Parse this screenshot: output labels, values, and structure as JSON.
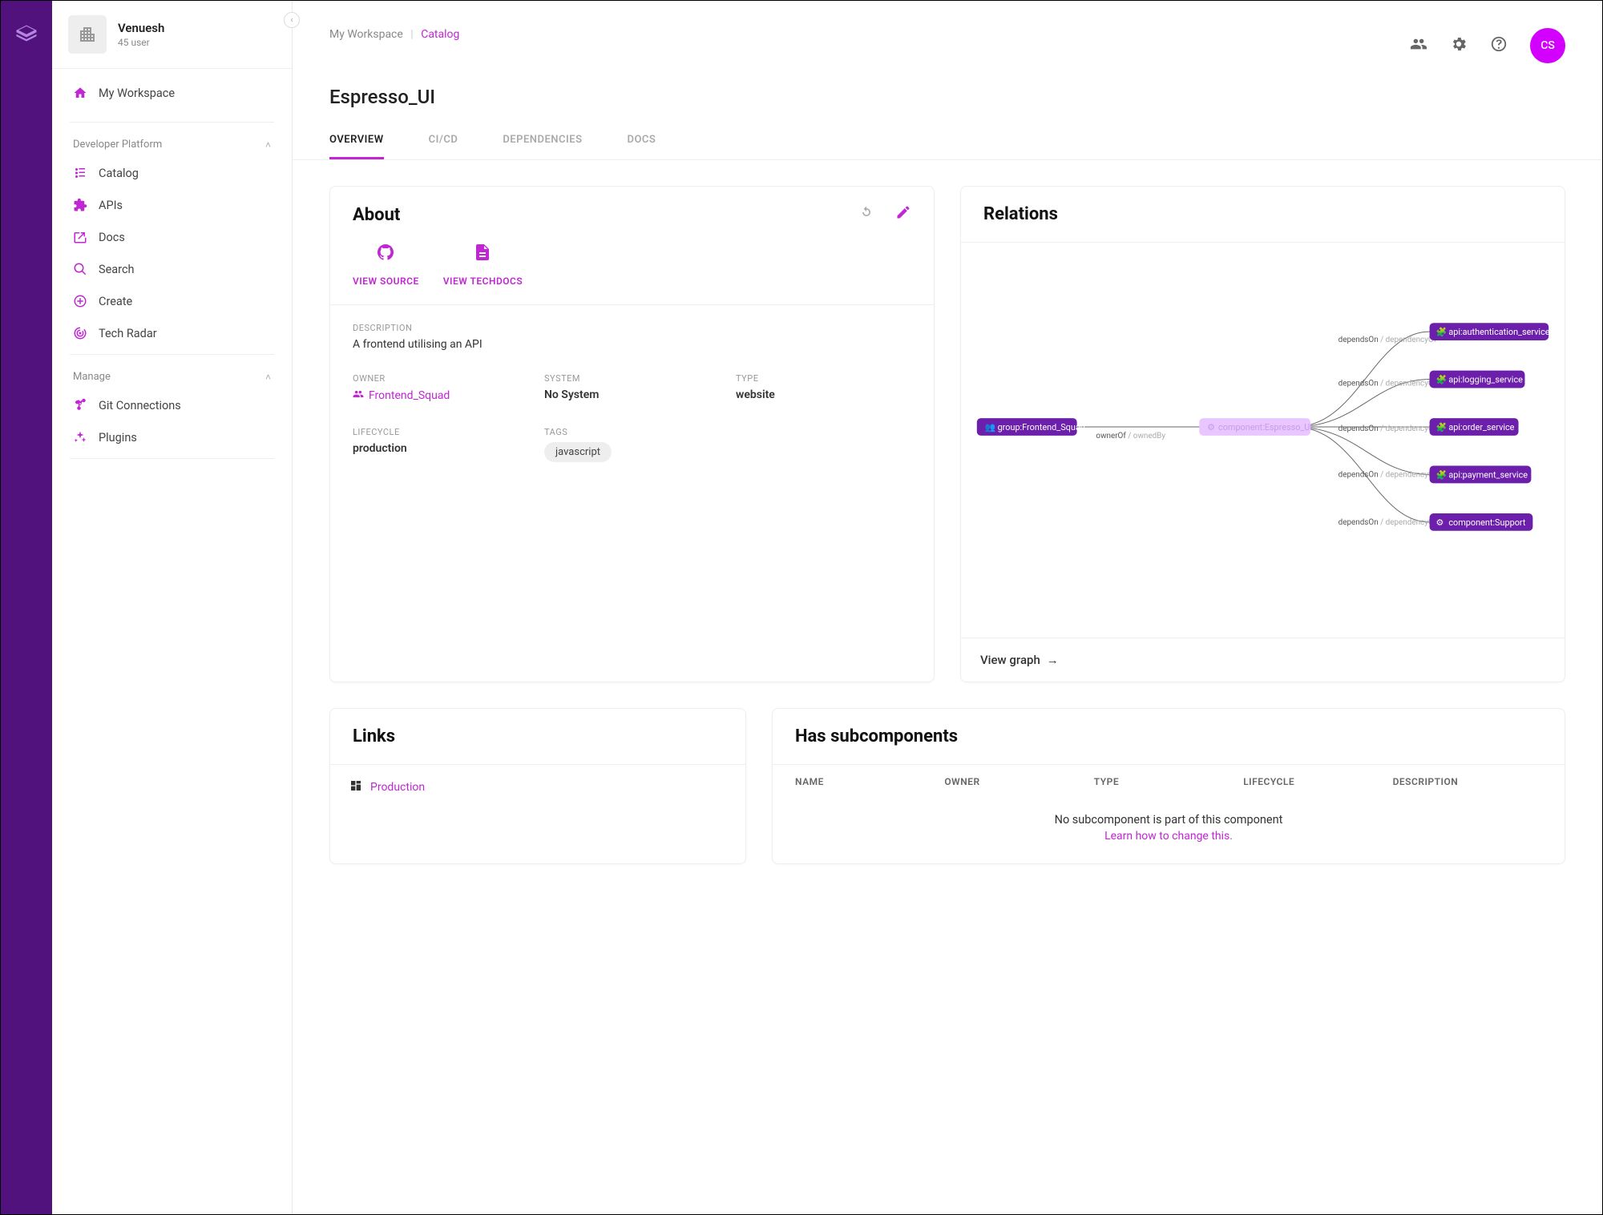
{
  "org": {
    "name": "Venuesh",
    "subtitle": "45 user"
  },
  "sidebar": {
    "top_item": "My Workspace",
    "dev_section_title": "Developer Platform",
    "dev_items": [
      "Catalog",
      "APIs",
      "Docs",
      "Search",
      "Create",
      "Tech Radar"
    ],
    "manage_section_title": "Manage",
    "manage_items": [
      "Git Connections",
      "Plugins"
    ]
  },
  "breadcrumb": {
    "root": "My Workspace",
    "current": "Catalog"
  },
  "page_title": "Espresso_UI",
  "avatar_initials": "CS",
  "tabs": [
    "OVERVIEW",
    "CI/CD",
    "DEPENDENCIES",
    "DOCS"
  ],
  "about": {
    "title": "About",
    "view_source": "VIEW SOURCE",
    "view_techdocs": "VIEW TECHDOCS",
    "description_label": "DESCRIPTION",
    "description": "A frontend utilising an API",
    "owner_label": "OWNER",
    "owner": "Frontend_Squad",
    "system_label": "SYSTEM",
    "system": "No System",
    "type_label": "TYPE",
    "type": "website",
    "lifecycle_label": "LIFECYCLE",
    "lifecycle": "production",
    "tags_label": "TAGS",
    "tags": [
      "javascript"
    ]
  },
  "relations": {
    "title": "Relations",
    "view_graph": "View graph",
    "owner_node": "group:Frontend_Squad",
    "main_node": "component:Espresso_UI",
    "owner_edge_a": "ownerOf",
    "owner_edge_b": "ownedBy",
    "dep_edge_a": "dependsOn",
    "dep_edge_b": "dependencyOf",
    "dep_nodes": [
      "api:authentication_service",
      "api:logging_service",
      "api:order_service",
      "api:payment_service",
      "component:Support"
    ]
  },
  "links": {
    "title": "Links",
    "items": [
      "Production"
    ]
  },
  "subcomponents": {
    "title": "Has subcomponents",
    "columns": [
      "NAME",
      "OWNER",
      "TYPE",
      "LIFECYCLE",
      "DESCRIPTION"
    ],
    "empty_msg": "No subcomponent is part of this component",
    "empty_link": "Learn how to change this."
  }
}
